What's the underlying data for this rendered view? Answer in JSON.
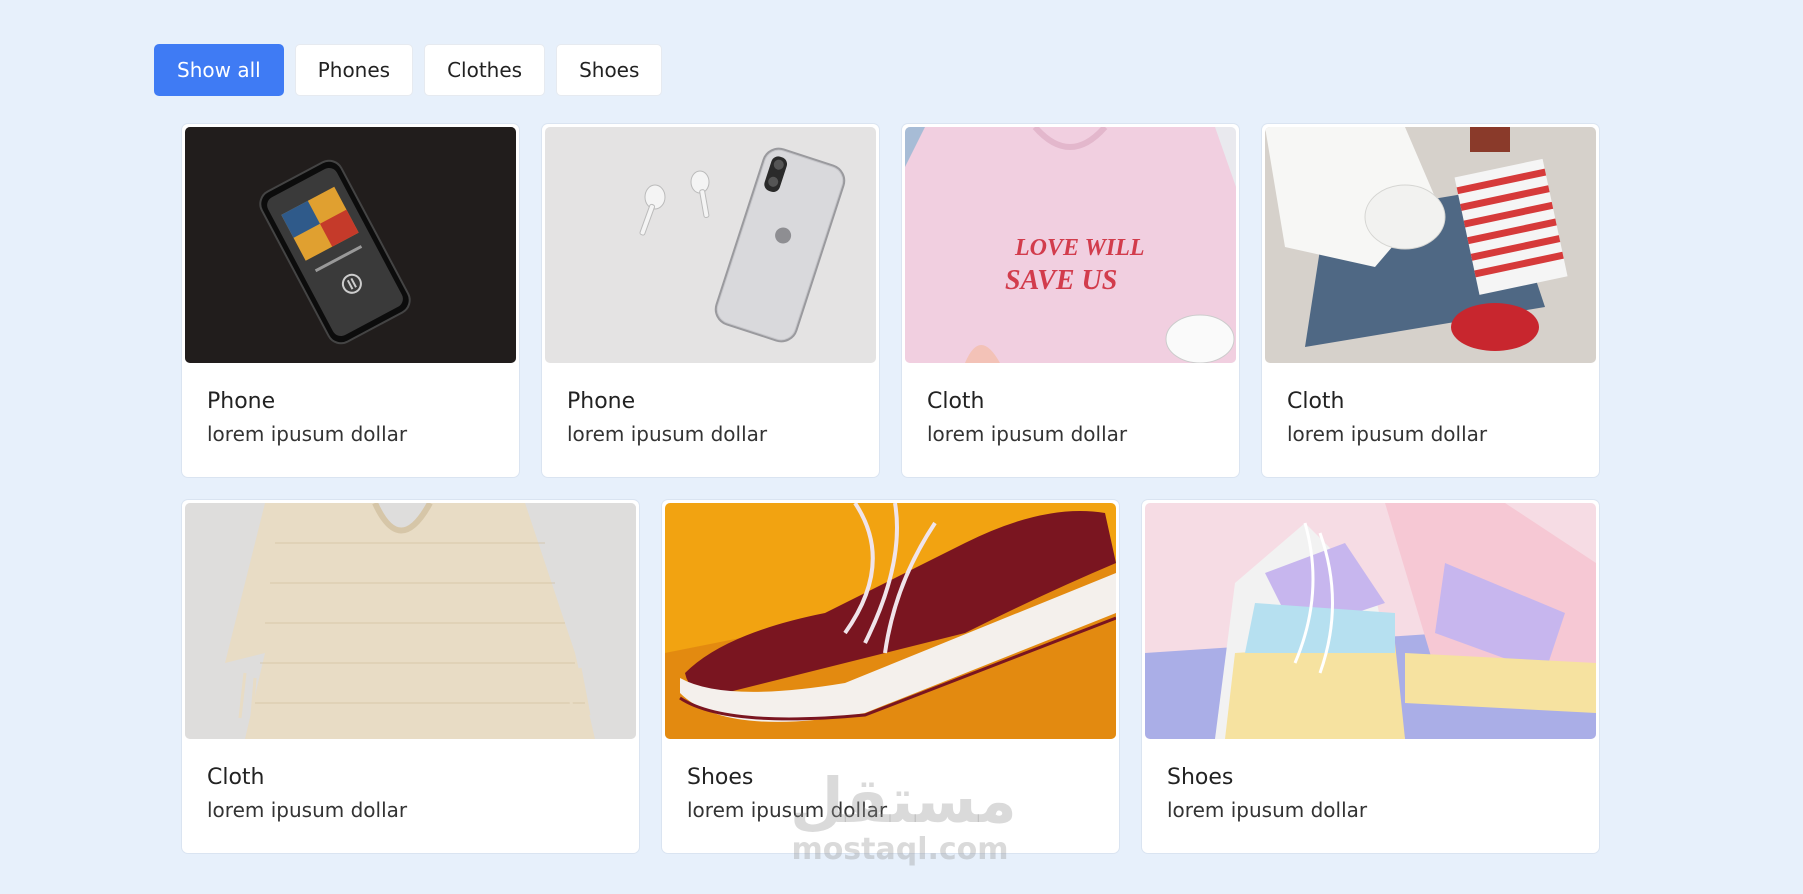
{
  "filters": [
    {
      "label": "Show all",
      "active": true
    },
    {
      "label": "Phones",
      "active": false
    },
    {
      "label": "Clothes",
      "active": false
    },
    {
      "label": "Shoes",
      "active": false
    }
  ],
  "cards": [
    {
      "title": "Phone",
      "desc": "lorem ipusum dollar",
      "image": "black-smartphone-music-player"
    },
    {
      "title": "Phone",
      "desc": "lorem ipusum dollar",
      "image": "white-iphone-airpods"
    },
    {
      "title": "Cloth",
      "desc": "lorem ipusum dollar",
      "image": "pink-tshirt-love-will-save-us",
      "image_text": [
        "LOVE WILL",
        "SAVE US"
      ]
    },
    {
      "title": "Cloth",
      "desc": "lorem ipusum dollar",
      "image": "jeans-white-shirt-striped-bag"
    },
    {
      "title": "Cloth",
      "desc": "lorem ipusum dollar",
      "image": "knit-beige-top"
    },
    {
      "title": "Shoes",
      "desc": "lorem ipusum dollar",
      "image": "maroon-sneaker-orange-bg"
    },
    {
      "title": "Shoes",
      "desc": "lorem ipusum dollar",
      "image": "pastel-sneakers"
    }
  ],
  "watermark": {
    "arabic": "مستقل",
    "latin": "mostaql.com"
  },
  "colors": {
    "background": "#e7f0fb",
    "accent": "#3f7bf4",
    "card": "#ffffff"
  }
}
